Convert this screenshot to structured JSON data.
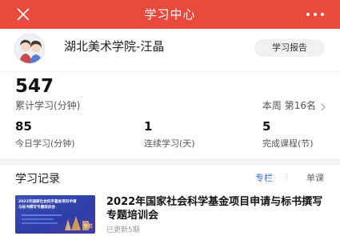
{
  "header": {
    "title": "学习中心",
    "close_icon": "close-icon",
    "more_icon": "more-dots-icon"
  },
  "profile": {
    "name": "湖北美术学院-汪晶",
    "report_button": "学习报告",
    "avatar_icon": "user-avatar"
  },
  "summary": {
    "total_minutes": "547",
    "total_label": "累计学习(分钟)",
    "week_rank": "本周 第16名"
  },
  "stats": [
    {
      "value": "85",
      "label": "今日学习(分钟)"
    },
    {
      "value": "1",
      "label": "连续学习(天)"
    },
    {
      "value": "5",
      "label": "完成课程(节)"
    }
  ],
  "records": {
    "title": "学习记录",
    "tab_column": "专栏",
    "tab_single": "单课",
    "items": [
      {
        "title": "2022年国家社会科学基金项目申请与标书撰写专题培训会",
        "meta": "已更新5期",
        "thumb_line1": "2022年国家社会科学基金项目申请",
        "thumb_line2": "与标书撰写专题培训会",
        "thumb_badge": "专栏"
      }
    ]
  },
  "colors": {
    "nav_bg": "#e84b3c",
    "accent_blue": "#3b6fd6"
  }
}
